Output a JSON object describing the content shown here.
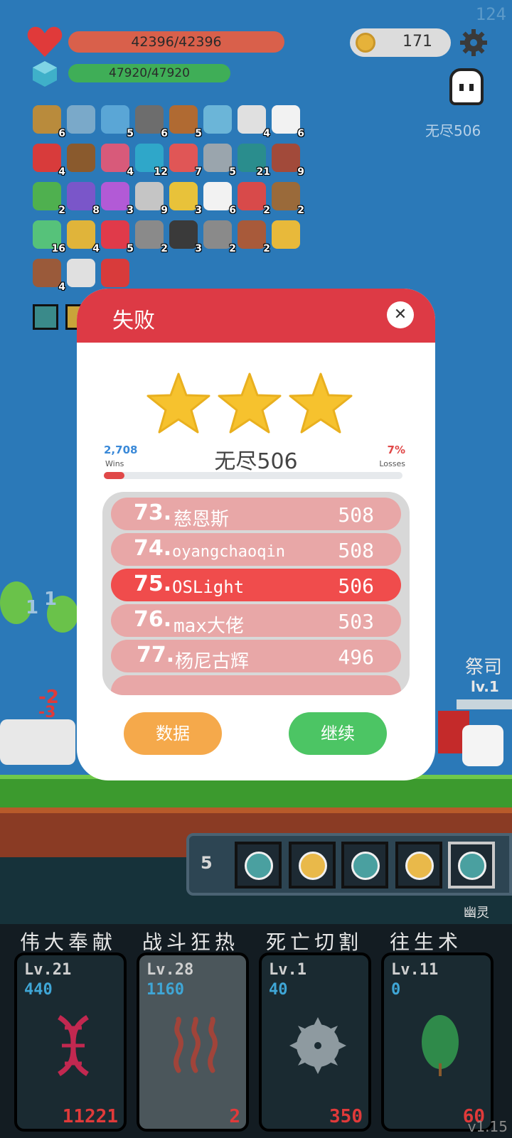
{
  "hud": {
    "fps": "124",
    "hp_text": "42396/42396",
    "mp_text": "47920/47920",
    "coins": "171",
    "stage_label": "无尽506"
  },
  "relics": [
    {
      "icon": "book-icon",
      "count": "6",
      "color": "#b98b3c"
    },
    {
      "icon": "magnifier-icon",
      "count": "",
      "color": "#7aa9c9"
    },
    {
      "icon": "potion-flask-icon",
      "count": "5",
      "color": "#5aa6d6"
    },
    {
      "icon": "compass-icon",
      "count": "6",
      "color": "#6d6d6d"
    },
    {
      "icon": "crossbow-icon",
      "count": "5",
      "color": "#b06a32"
    },
    {
      "icon": "mask-icon",
      "count": "",
      "color": "#6bb5d8"
    },
    {
      "icon": "envelope-icon",
      "count": "4",
      "color": "#e0e0e0"
    },
    {
      "icon": "dice-icon",
      "count": "6",
      "color": "#f2f2f2"
    },
    {
      "icon": "apple-icon",
      "count": "4",
      "color": "#d83b3b"
    },
    {
      "icon": "chest-icon",
      "count": "",
      "color": "#8a5a2d"
    },
    {
      "icon": "jar-icon",
      "count": "4",
      "color": "#d85a7a"
    },
    {
      "icon": "gem-icon",
      "count": "12",
      "color": "#2fa7c9"
    },
    {
      "icon": "pill-icon",
      "count": "7",
      "color": "#e05656"
    },
    {
      "icon": "axe-icon",
      "count": "5",
      "color": "#9aa5ad"
    },
    {
      "icon": "chat-bubble-icon",
      "count": "21",
      "color": "#2a8d8d"
    },
    {
      "icon": "door-icon",
      "count": "9",
      "color": "#a24a3a"
    },
    {
      "icon": "watermelon-icon",
      "count": "2",
      "color": "#4fb04f"
    },
    {
      "icon": "magic-box-icon",
      "count": "8",
      "color": "#7a56c9"
    },
    {
      "icon": "crystal-ball-icon",
      "count": "3",
      "color": "#b25ad6"
    },
    {
      "icon": "fish-icon",
      "count": "9",
      "color": "#c5c5c5"
    },
    {
      "icon": "wand-icon",
      "count": "3",
      "color": "#e8c23a"
    },
    {
      "icon": "ghost-icon",
      "count": "6",
      "color": "#f2f2f2"
    },
    {
      "icon": "shield-icon",
      "count": "2",
      "color": "#d84a4a"
    },
    {
      "icon": "sword-icon",
      "count": "2",
      "color": "#9a6a3a"
    },
    {
      "icon": "green-potion-icon",
      "count": "16",
      "color": "#56c27a"
    },
    {
      "icon": "ring-icon",
      "count": "4",
      "color": "#e0b43a"
    },
    {
      "icon": "strawberry-icon",
      "count": "5",
      "color": "#e03a4a"
    },
    {
      "icon": "meteor-icon",
      "count": "2",
      "color": "#8a8a8a"
    },
    {
      "icon": "pig-icon",
      "count": "3",
      "color": "#3a3a3a"
    },
    {
      "icon": "spiked-mace-icon",
      "count": "2",
      "color": "#8a8a8a"
    },
    {
      "icon": "round-shield-icon",
      "count": "2",
      "color": "#a85a3a"
    },
    {
      "icon": "sunflower-icon",
      "count": "",
      "color": "#e8b93a"
    },
    {
      "icon": "cake-icon",
      "count": "4",
      "color": "#9a5a3a"
    },
    {
      "icon": "hook-icon",
      "count": "",
      "color": "#e0e0e0"
    },
    {
      "icon": "hearts-icon",
      "count": "",
      "color": "#d83b3b"
    }
  ],
  "battlefield": {
    "floating_numbers": [
      "1",
      "1"
    ],
    "tag_left": "-2",
    "tag_left2": "-3",
    "priest_name": "祭司",
    "priest_level": "lv.1",
    "potion_count": "5",
    "ghost_label": "幽灵"
  },
  "modal": {
    "title": "失败",
    "close_label": "✕",
    "stars": 3,
    "wins_value": "2,708",
    "wins_label": "Wins",
    "losses_value": "7%",
    "losses_label": "Losses",
    "stage_title": "无尽506",
    "progress_fraction": 0.07,
    "leaderboard": [
      {
        "rank": "73.",
        "name": "慈恩斯",
        "score": "508",
        "me": false
      },
      {
        "rank": "74.",
        "name": "oyangchaoqin",
        "score": "508",
        "me": false
      },
      {
        "rank": "75.",
        "name": "OSLight",
        "score": "506",
        "me": true
      },
      {
        "rank": "76.",
        "name": "max大佬",
        "score": "503",
        "me": false
      },
      {
        "rank": "77.",
        "name": "杨尼古辉",
        "score": "496",
        "me": false
      }
    ],
    "data_button": "数据",
    "continue_button": "继续"
  },
  "skills": [
    {
      "name": "伟大奉献",
      "level": "Lv.21",
      "cost": "440",
      "count": "11221",
      "icon": "dna-icon"
    },
    {
      "name": "战斗狂热",
      "level": "Lv.28",
      "cost": "1160",
      "count": "2",
      "icon": "heat-waves-icon"
    },
    {
      "name": "死亡切割",
      "level": "Lv.1",
      "cost": "40",
      "count": "350",
      "icon": "saw-blade-icon"
    },
    {
      "name": "往生术",
      "level": "Lv.11",
      "cost": "0",
      "count": "60",
      "icon": "leaf-icon"
    }
  ],
  "version": "v1.15"
}
